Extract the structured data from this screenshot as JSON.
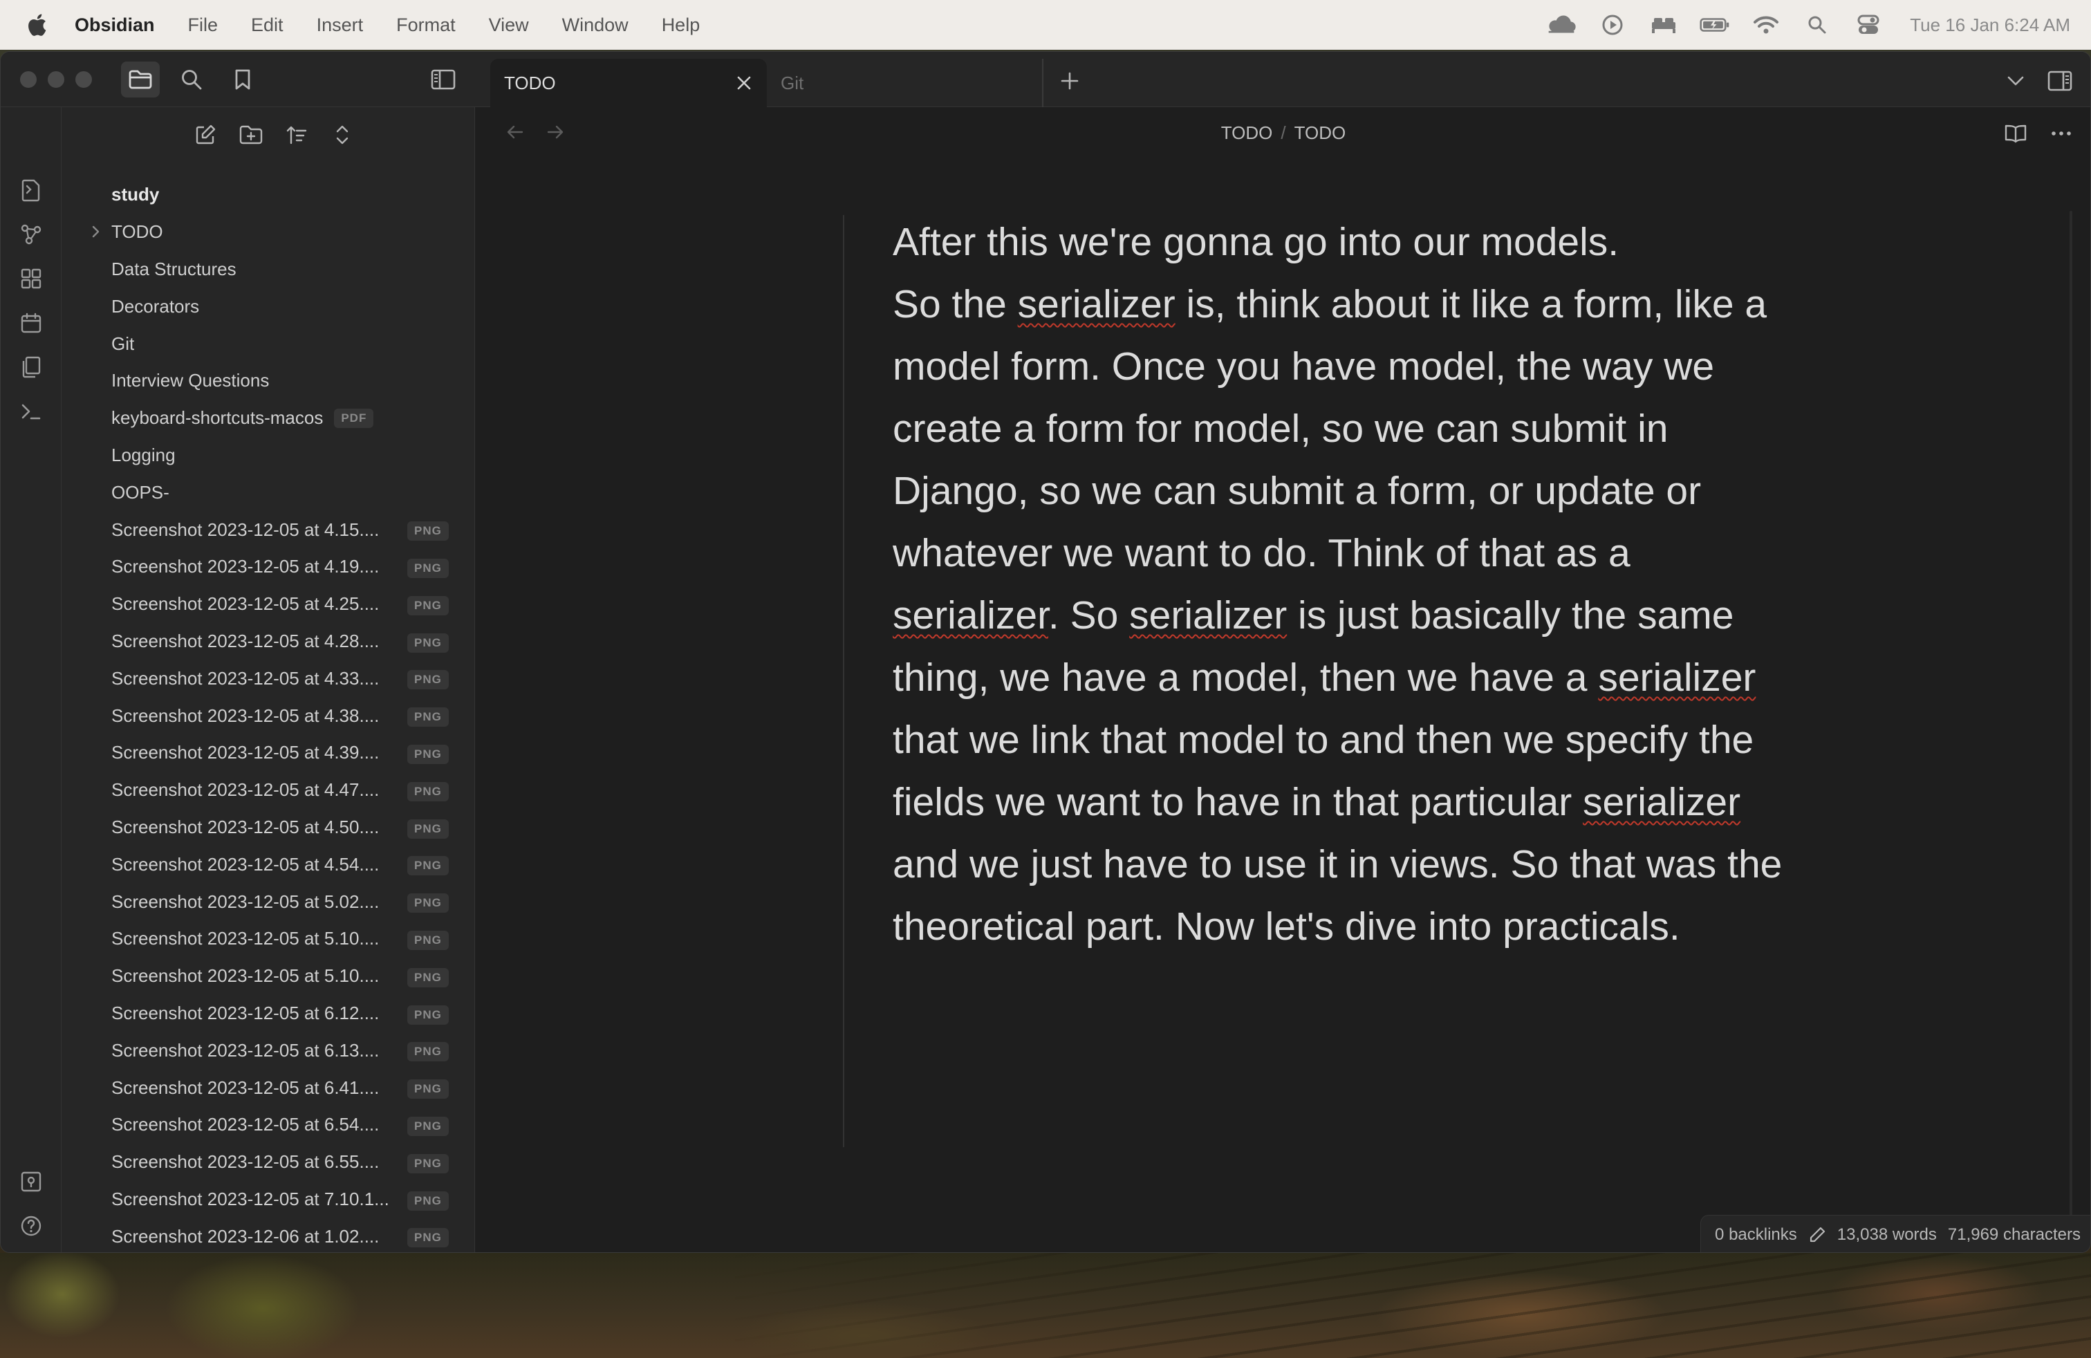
{
  "menubar": {
    "app_name": "Obsidian",
    "menus": [
      "File",
      "Edit",
      "Insert",
      "Format",
      "View",
      "Window",
      "Help"
    ],
    "clock": "Tue 16 Jan  6:24 AM",
    "status_icons": [
      "cloud-icon",
      "play-circle-icon",
      "bed-icon",
      "battery-icon",
      "wifi-icon",
      "search-icon",
      "control-center-icon"
    ]
  },
  "tabs": [
    {
      "label": "TODO",
      "active": true
    },
    {
      "label": "Git",
      "active": false
    }
  ],
  "breadcrumb": {
    "folder": "TODO",
    "separator": "/",
    "file": "TODO"
  },
  "explorer": {
    "root": "study",
    "items": [
      {
        "name": "TODO",
        "folder": true
      },
      {
        "name": "Data Structures"
      },
      {
        "name": "Decorators"
      },
      {
        "name": "Git"
      },
      {
        "name": "Interview Questions"
      },
      {
        "name": "keyboard-shortcuts-macos",
        "badge": "PDF"
      },
      {
        "name": "Logging"
      },
      {
        "name": "OOPS-"
      },
      {
        "name": "Screenshot 2023-12-05 at 4.15....",
        "badge": "PNG"
      },
      {
        "name": "Screenshot 2023-12-05 at 4.19....",
        "badge": "PNG"
      },
      {
        "name": "Screenshot 2023-12-05 at 4.25....",
        "badge": "PNG"
      },
      {
        "name": "Screenshot 2023-12-05 at 4.28....",
        "badge": "PNG"
      },
      {
        "name": "Screenshot 2023-12-05 at 4.33....",
        "badge": "PNG"
      },
      {
        "name": "Screenshot 2023-12-05 at 4.38....",
        "badge": "PNG"
      },
      {
        "name": "Screenshot 2023-12-05 at 4.39....",
        "badge": "PNG"
      },
      {
        "name": "Screenshot 2023-12-05 at 4.47....",
        "badge": "PNG"
      },
      {
        "name": "Screenshot 2023-12-05 at 4.50....",
        "badge": "PNG"
      },
      {
        "name": "Screenshot 2023-12-05 at 4.54....",
        "badge": "PNG"
      },
      {
        "name": "Screenshot 2023-12-05 at 5.02....",
        "badge": "PNG"
      },
      {
        "name": "Screenshot 2023-12-05 at 5.10....",
        "badge": "PNG"
      },
      {
        "name": "Screenshot 2023-12-05 at 5.10....",
        "badge": "PNG"
      },
      {
        "name": "Screenshot 2023-12-05 at 6.12....",
        "badge": "PNG"
      },
      {
        "name": "Screenshot 2023-12-05 at 6.13....",
        "badge": "PNG"
      },
      {
        "name": "Screenshot 2023-12-05 at 6.41....",
        "badge": "PNG"
      },
      {
        "name": "Screenshot 2023-12-05 at 6.54....",
        "badge": "PNG"
      },
      {
        "name": "Screenshot 2023-12-05 at 6.55....",
        "badge": "PNG"
      },
      {
        "name": "Screenshot 2023-12-05 at 7.10.1...",
        "badge": "PNG"
      },
      {
        "name": "Screenshot 2023-12-06 at 1.02....",
        "badge": "PNG"
      }
    ]
  },
  "editor": {
    "paragraph_1": "After this we're gonna go into our models.",
    "segments": [
      {
        "text": "So the ",
        "flag": false
      },
      {
        "text": "serializer",
        "flag": true
      },
      {
        "text": " is, think about it like a form, like a model form. Once you have model, the way we create a form for model, so we can submit in Django, so we can submit a form, or update or whatever we want to do. Think of that as a ",
        "flag": false
      },
      {
        "text": "serializer",
        "flag": true
      },
      {
        "text": ". So ",
        "flag": false
      },
      {
        "text": "serializer",
        "flag": true
      },
      {
        "text": " is just basically the same thing, we have a model, then we have a ",
        "flag": false
      },
      {
        "text": "serializer",
        "flag": true
      },
      {
        "text": " that we link that model to and then we specify the fields we want to have in that particular ",
        "flag": false
      },
      {
        "text": "serializer",
        "flag": true
      },
      {
        "text": " and we just have to use it in views. So that was the theoretical part. Now let's dive into practicals.",
        "flag": false
      }
    ]
  },
  "status": {
    "backlinks": "0 backlinks",
    "words": "13,038 words",
    "characters": "71,969 characters"
  },
  "colors": {
    "background": "#1e1e1e",
    "panel": "#262626",
    "text": "#dcdcdc",
    "spellcheck": "#c0392b"
  }
}
